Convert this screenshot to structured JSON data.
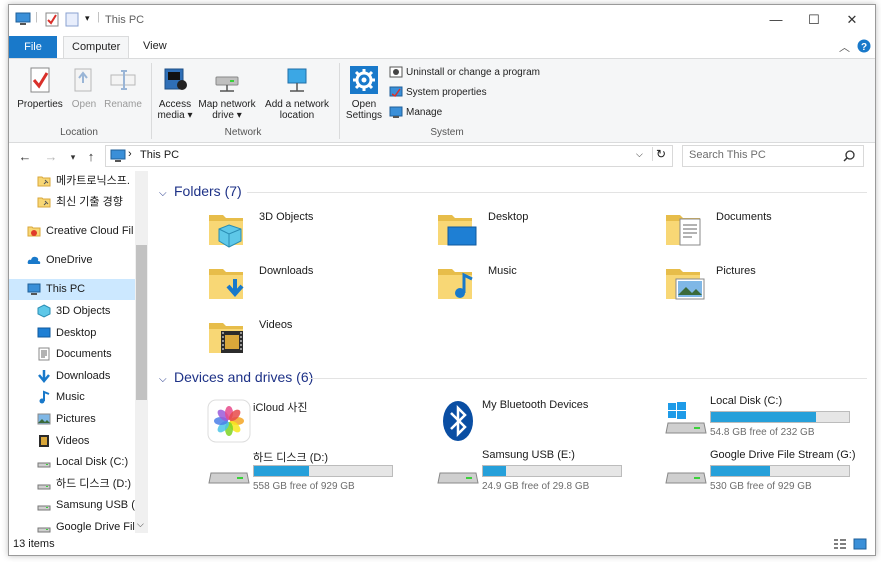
{
  "window": {
    "title": "This PC"
  },
  "ribbon": {
    "tabs": {
      "file": "File",
      "computer": "Computer",
      "view": "View"
    },
    "location": {
      "label": "Location",
      "properties": "Properties",
      "open": "Open",
      "rename": "Rename"
    },
    "network": {
      "label": "Network",
      "access_media_1": "Access",
      "access_media_2": "media ▾",
      "map_drive_1": "Map network",
      "map_drive_2": "drive ▾",
      "add_location_1": "Add a network",
      "add_location_2": "location"
    },
    "system": {
      "label": "System",
      "open_settings_1": "Open",
      "open_settings_2": "Settings",
      "uninstall": "Uninstall or change a program",
      "system_properties": "System properties",
      "manage": "Manage"
    }
  },
  "addressbar": {
    "path": "This PC",
    "search_placeholder": "Search This PC"
  },
  "navpane": {
    "items": [
      {
        "label": "메카트로닉스프.",
        "icon": "folder-pin-icon"
      },
      {
        "label": "최신 기출 경향",
        "icon": "folder-pin-icon"
      },
      {
        "label": "Creative Cloud Fil",
        "icon": "creative-cloud-icon"
      },
      {
        "label": "OneDrive",
        "icon": "onedrive-icon"
      },
      {
        "label": "This PC",
        "icon": "computer-icon"
      },
      {
        "label": "3D Objects",
        "icon": "3d-objects-icon"
      },
      {
        "label": "Desktop",
        "icon": "desktop-icon"
      },
      {
        "label": "Documents",
        "icon": "documents-icon"
      },
      {
        "label": "Downloads",
        "icon": "downloads-icon"
      },
      {
        "label": "Music",
        "icon": "music-icon"
      },
      {
        "label": "Pictures",
        "icon": "pictures-icon"
      },
      {
        "label": "Videos",
        "icon": "videos-icon"
      },
      {
        "label": "Local Disk (C:)",
        "icon": "drive-icon"
      },
      {
        "label": "하드 디스크 (D:)",
        "icon": "drive-icon"
      },
      {
        "label": "Samsung USB (E",
        "icon": "drive-icon"
      },
      {
        "label": "Google Drive File",
        "icon": "drive-icon"
      }
    ]
  },
  "content": {
    "folders_header": "Folders (7)",
    "folders": [
      {
        "name": "3D Objects",
        "icon": "3d-objects-folder-icon"
      },
      {
        "name": "Desktop",
        "icon": "desktop-folder-icon"
      },
      {
        "name": "Documents",
        "icon": "documents-folder-icon"
      },
      {
        "name": "Downloads",
        "icon": "downloads-folder-icon"
      },
      {
        "name": "Music",
        "icon": "music-folder-icon"
      },
      {
        "name": "Pictures",
        "icon": "pictures-folder-icon"
      },
      {
        "name": "Videos",
        "icon": "videos-folder-icon"
      }
    ],
    "devices_header": "Devices and drives (6)",
    "devices": [
      {
        "name": "iCloud 사진",
        "icon": "icloud-photos-icon"
      },
      {
        "name": "My Bluetooth Devices",
        "icon": "bluetooth-icon"
      },
      {
        "name": "Local Disk (C:)",
        "free": "54.8 GB free of 232 GB",
        "used_fraction": 0.76,
        "icon": "windows-drive-icon"
      },
      {
        "name": "하드 디스크 (D:)",
        "free": "558 GB free of 929 GB",
        "used_fraction": 0.4,
        "icon": "hard-drive-icon"
      },
      {
        "name": "Samsung USB (E:)",
        "free": "24.9 GB free of 29.8 GB",
        "used_fraction": 0.17,
        "icon": "usb-drive-icon"
      },
      {
        "name": "Google Drive File Stream (G:)",
        "free": "530 GB free of 929 GB",
        "used_fraction": 0.43,
        "icon": "hard-drive-icon"
      }
    ]
  },
  "statusbar": {
    "item_count": "13 items"
  },
  "colors": {
    "accent": "#1979ca",
    "selection": "#cce8ff",
    "drive_bar": "#26a0da",
    "group_header": "#1e3287"
  }
}
